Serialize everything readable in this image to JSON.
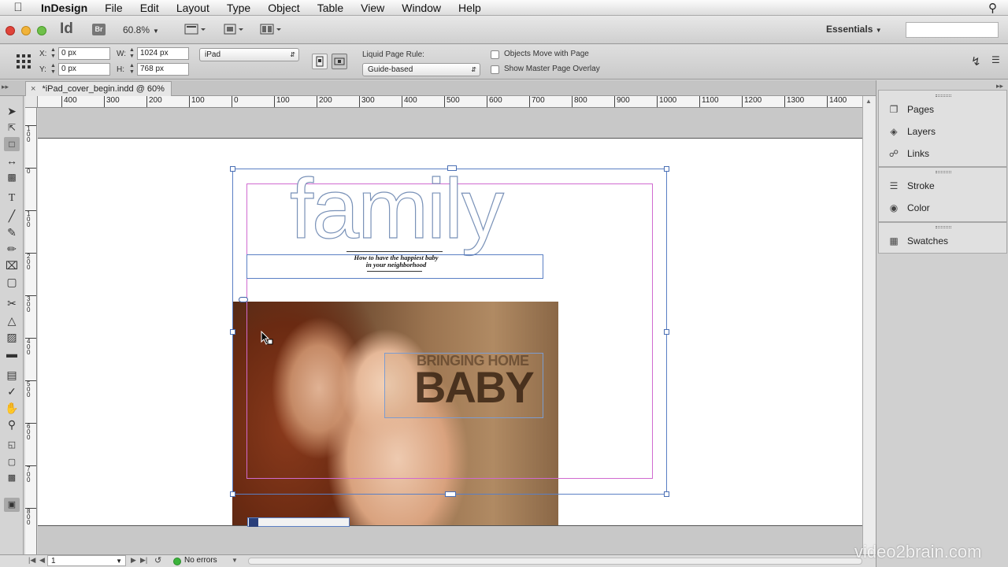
{
  "menubar": {
    "app": "InDesign",
    "items": [
      "File",
      "Edit",
      "Layout",
      "Type",
      "Object",
      "Table",
      "View",
      "Window",
      "Help"
    ]
  },
  "appbar": {
    "logo": "Id",
    "bridge": "Br",
    "zoom": "60.8%",
    "workspace": "Essentials"
  },
  "control": {
    "x_label": "X:",
    "x_value": "0 px",
    "y_label": "Y:",
    "y_value": "0 px",
    "w_label": "W:",
    "w_value": "1024 px",
    "h_label": "H:",
    "h_value": "768 px",
    "preset": "iPad",
    "liquid_label": "Liquid Page Rule:",
    "liquid_value": "Guide-based",
    "objects_move": "Objects Move with Page",
    "master_overlay": "Show Master Page Overlay"
  },
  "document": {
    "tab_title": "*iPad_cover_begin.indd @ 60%"
  },
  "hruler": [
    "400",
    "300",
    "200",
    "100",
    "0",
    "100",
    "200",
    "300",
    "400",
    "500",
    "600",
    "700",
    "800",
    "900",
    "1000",
    "1100",
    "1200",
    "1300",
    "1400"
  ],
  "vruler": [
    "1\n0\n0",
    "0",
    "1\n0\n0",
    "2\n0\n0",
    "3\n0\n0",
    "4\n0\n0",
    "5\n0\n0",
    "6\n0\n0",
    "7\n0\n0",
    "8\n0\n0"
  ],
  "design": {
    "masthead": "family",
    "tagline_1": "How to have the happiest baby",
    "tagline_2": "in your neighborhood",
    "cover_small": "BRINGING HOME",
    "cover_big": "BABY"
  },
  "status": {
    "page": "1",
    "errors": "No errors"
  },
  "panels": {
    "group1": [
      "Pages",
      "Layers",
      "Links"
    ],
    "group2": [
      "Stroke",
      "Color"
    ],
    "group3": [
      "Swatches"
    ]
  },
  "watermark": "video2brain.com"
}
